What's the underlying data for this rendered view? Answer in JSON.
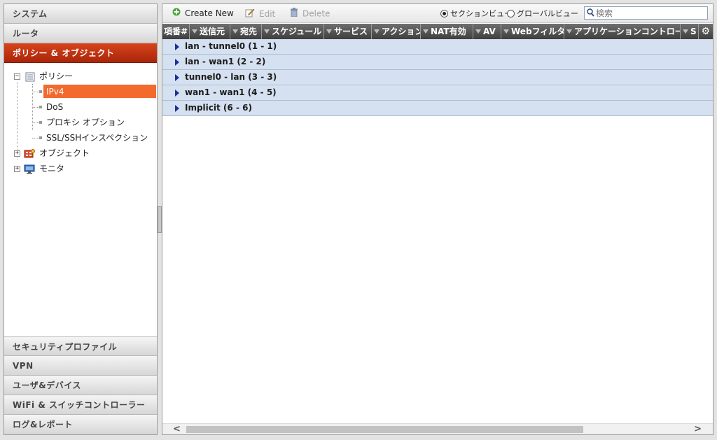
{
  "nav": {
    "sections": [
      {
        "label": "システム"
      },
      {
        "label": "ルータ"
      },
      {
        "label": "ポリシー & オブジェクト"
      }
    ],
    "tree": {
      "policy": "ポリシー",
      "policy_children": [
        "IPv4",
        "DoS",
        "プロキシ オプション",
        "SSL/SSHインスペクション"
      ],
      "objects": "オブジェクト",
      "monitor": "モニタ"
    },
    "bottom_sections": [
      {
        "label": "セキュリティプロファイル"
      },
      {
        "label": "VPN"
      },
      {
        "label": "ユーザ&デバイス"
      },
      {
        "label": "WiFi & スイッチコントローラー"
      },
      {
        "label": "ログ&レポート"
      }
    ]
  },
  "toolbar": {
    "create_new": "Create New",
    "edit": "Edit",
    "delete": "Delete",
    "section_view": "セクションビュー",
    "global_view": "グローバルビュー",
    "search_placeholder": "検索"
  },
  "columns": [
    "項番#",
    "送信元",
    "宛先",
    "スケジュール",
    "サービス",
    "アクション",
    "NAT有効",
    "AV",
    "Webフィルタ",
    "アプリケーションコントロール",
    "S"
  ],
  "policy_sections": [
    "lan - tunnel0 (1 - 1)",
    "lan - wan1 (2 - 2)",
    "tunnel0 - lan (3 - 3)",
    "wan1 - wan1 (4 - 5)",
    "Implicit (6 - 6)"
  ],
  "colors": {
    "active_section": "#c0340f",
    "selected_item": "#f26a2e",
    "section_row_bg": "#d5e1f0"
  }
}
